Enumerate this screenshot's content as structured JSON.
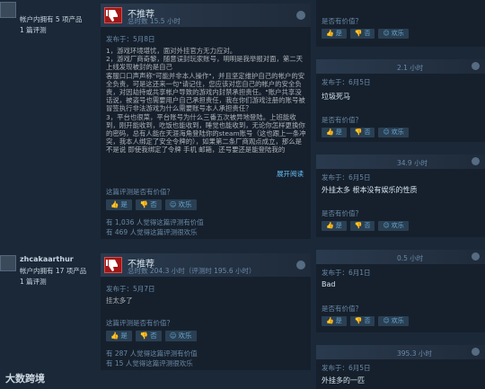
{
  "review1": {
    "owned": "帐户内拥有 5 项产品",
    "reviews_count": "1 篇评测",
    "verdict": "不推荐",
    "hours": "总时数 15.5 小时",
    "posted": "发布于：5月8日",
    "body": "1，游戏环境堪忧，面对外挂官方无力应对。\n2，游戏厂商奇黎，随意误封玩家账号，明明是我举报对面，第二天上线发现被封的是自己\n客服口口声声称\"可能并非本人操作\"，并且坚定维护自己的帐户的安全负责，可是这还来一句\"请记住，您应该对您自己的帐户的安全负责，对因劫持或共享帐户导致的游戏内封禁承担责任。\"账户共享没话说，被盗号也需要用户自己承担责任，我在你们游戏注册的账号被冒签执行非法游戏为什么需要账号本人承担责任？\n3，平台也很菜，平台账号为什么三番五次被异地登陆。上班能收到，刚开能收到，吃饭也能收到，睡觉也能收到，无论你怎样更换你的密码，总有人能在天涯海角登陆你的steam账号（这也跟上一条冲突，我本人绑定了安全令牌的），如果第二条厂商观点成立，那么是不是说 即使我绑定了令牌 手机 邮箱，还号要还是能登陆我的",
    "expand": "展开阅读",
    "helpful_q": "这篇评测是否有价值？",
    "yes": "是",
    "no": "否",
    "funny": "欢乐",
    "stat1": "有 1,036 人觉得这篇评测有价值",
    "stat2": "有 469 人觉得这篇评测很欢乐"
  },
  "review2": {
    "author": "zhcakaarthur",
    "owned": "帐户内拥有 17 项产品",
    "reviews_count": "1 篇评测",
    "verdict": "不推荐",
    "hours": "总时数 204.3 小时（评测时 195.6 小时）",
    "posted": "发布于：5月7日",
    "body": "挂太多了",
    "helpful_q": "这篇评测是否有价值？",
    "yes": "是",
    "no": "否",
    "funny": "欢乐",
    "stat1": "有 287 人觉得这篇评测有价值",
    "stat2": "有 15 人觉得这篇评测很欢乐"
  },
  "right": [
    {
      "hours": "",
      "posted": "",
      "text": "",
      "helpful_q": "是否有价值？",
      "yes": "是",
      "no": "否",
      "funny": "欢乐"
    },
    {
      "hours": "2.1 小时",
      "posted": "发布于：6月5日",
      "text": "垃圾死马",
      "helpful_q": "是否有价值？",
      "yes": "是",
      "no": "否",
      "funny": "欢乐"
    },
    {
      "hours": "34.9 小时",
      "posted": "发布于：6月5日",
      "text": "外挂太多 根本没有娱乐的性质",
      "helpful_q": "是否有价值？",
      "yes": "是",
      "no": "否",
      "funny": "欢乐"
    },
    {
      "hours": "0.5 小时",
      "posted": "发布于：6月1日",
      "text": "Bad",
      "helpful_q": "是否有价值？",
      "yes": "是",
      "no": "否",
      "funny": "欢乐"
    },
    {
      "hours": "395.3 小时",
      "posted": "发布于：6月5日",
      "text": "外挂多的一匹",
      "helpful_q": "",
      "yes": "",
      "no": "",
      "funny": ""
    }
  ],
  "watermark": "大数跨境",
  "colors": {
    "background": "#1b2838",
    "card": "#16202d",
    "thumb_down": "#a31616",
    "link": "#66c0f4"
  }
}
